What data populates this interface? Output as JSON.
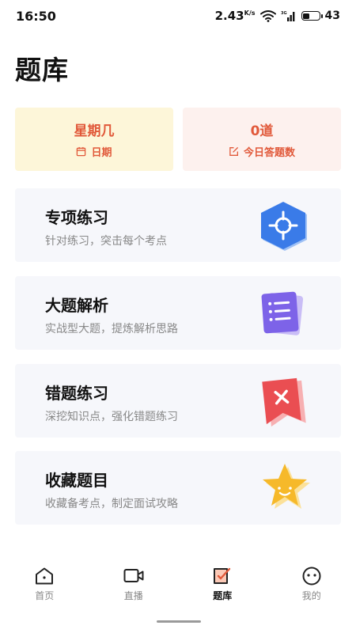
{
  "status_bar": {
    "time": "16:50",
    "speed_value": "2.43",
    "speed_unit": "K/s",
    "signal_label": "3G",
    "battery": "43",
    "battery_level": 0.43
  },
  "page": {
    "title": "题库"
  },
  "stats": [
    {
      "value": "星期几",
      "label": "日期",
      "icon": "calendar-icon"
    },
    {
      "value": "0道",
      "label": "今日答题数",
      "icon": "edit-icon"
    }
  ],
  "cards": [
    {
      "title": "专项练习",
      "desc": "针对练习，突击每个考点",
      "icon": "target-hexagon-icon",
      "color": "#3a7be8"
    },
    {
      "title": "大题解析",
      "desc": "实战型大题，提炼解析思路",
      "icon": "list-document-icon",
      "color": "#7d63e8"
    },
    {
      "title": "错题练习",
      "desc": "深挖知识点，强化错题练习",
      "icon": "error-bookmark-icon",
      "color": "#ea4e52"
    },
    {
      "title": "收藏题目",
      "desc": "收藏备考点，制定面试攻略",
      "icon": "star-smile-icon",
      "color": "#f6b92a"
    }
  ],
  "tabs": [
    {
      "label": "首页",
      "icon": "home-icon",
      "active": false
    },
    {
      "label": "直播",
      "icon": "video-camera-icon",
      "active": false
    },
    {
      "label": "题库",
      "icon": "question-bank-icon",
      "active": true
    },
    {
      "label": "我的",
      "icon": "profile-face-icon",
      "active": false
    }
  ],
  "colors": {
    "accent": "#e1593a",
    "date_card_bg": "#fdf6d9",
    "count_card_bg": "#fdf1ee",
    "card_bg": "#f6f7fb"
  }
}
